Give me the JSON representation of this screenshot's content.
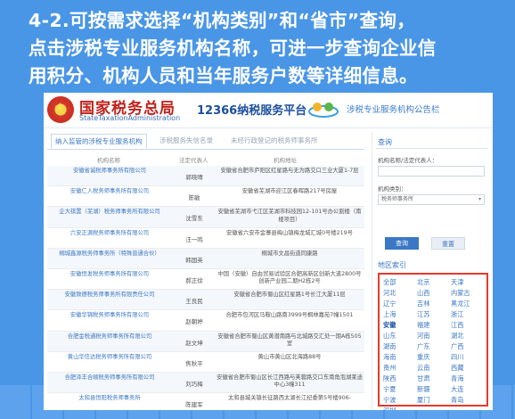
{
  "headline": {
    "line1": "4-2.可按需求选择“机构类别”和“省市”查询，",
    "line2": "点击涉税专业服务机构名称，可进一步查询企业信",
    "line3": "用积分、机构人员和当年服务户数等详细信息。"
  },
  "banner": {
    "org_cn": "国家税务总局",
    "org_en": "StateTaxationAdministration",
    "platform": "12366纳税服务平台",
    "subtitle": "涉税专业服务机构公告栏"
  },
  "tabs": [
    {
      "label": "纳入监管的涉税专业服务机构",
      "active": true
    },
    {
      "label": "涉税服务失信名录",
      "active": false
    },
    {
      "label": "未经行政登记的税务师事务所",
      "active": false
    }
  ],
  "table": {
    "headers": [
      "机构名称",
      "法定代表人",
      "机构地址"
    ],
    "rows": [
      {
        "name": "安徽省诚税师事务所有限公司",
        "rep": "郭晓晴",
        "addr": "安徽省合肥市庐阳区红星路与无为路交口三业大厦1-7层"
      },
      {
        "name": "安徽仁人税务师事务所有限公司",
        "rep": "陈敏",
        "addr": "安徽省芜湖市迎江区春晖路217号房屋"
      },
      {
        "name": "企大祺置（芜湖）税务师事务所有限公司",
        "rep": "沈雪东",
        "addr": "安徽省芜湖市弋江区芜湖市科技园12-101号办公割楼（南楼项目）"
      },
      {
        "name": "六安正源税务师事务所有限公司",
        "rep": "汪一鸣",
        "addr": "安徽省六安市金寨县梅山镇梅龙城汇城0号楼219号"
      },
      {
        "name": "桐城鑫源税务师事务所（特殊普通合伙）",
        "rep": "韩国英",
        "addr": "桐城市文昌街道同康路"
      },
      {
        "name": "安徽恒发税务师事务所有限公司",
        "rep": "郝正徐",
        "addr": "中国（安徽）自由贸易试验区合肥高新区创新大道2800号创新产业园二期H2栋2号"
      },
      {
        "name": "安徽致德税务师事务所有限责任公司",
        "rep": "王良民",
        "addr": "安徽省合肥市蜀山区红星路1号长江大厦11层"
      },
      {
        "name": "安徽华锦税务师事务所有限公司",
        "rep": "赵朝婷",
        "addr": "合肥市包河区马鞍山路南3999号桐林嘉苑7幢1501"
      },
      {
        "name": "合肥金税通税务师事务所有限公司",
        "rep": "赵文坤",
        "addr": "安徽省合肥市蜀山区黄潜南路与北城路交汇处一期A栋505室"
      },
      {
        "name": "黄山华信达税务师事务所有限公司",
        "rep": "焦秋平",
        "addr": "黄山市黄山区北海路88号"
      },
      {
        "name": "合肥泽丰合顺税务师事务所有限公司",
        "rep": "刘巧梅",
        "addr": "安徽省合肥市蜀山区长江西路与芙蓉路交口东南角泡湖莱迪中心3幢311"
      },
      {
        "name": "太和县恒阳税务师事务所",
        "rep": "陈建军",
        "addr": "太和县城关镇长征路西太湖长江纪委第5号楼906-"
      }
    ]
  },
  "query": {
    "title": "查询",
    "name_label": "机构名称/法定代表人：",
    "name_value": "",
    "category_label": "机构类别：",
    "category_value": "税务师事务所",
    "query_button": "查询",
    "reset_button": "重置"
  },
  "regions": {
    "title": "地区索引",
    "items": [
      "全部",
      "北京",
      "天津",
      "河北",
      "山西",
      "内蒙古",
      "辽宁",
      "吉林",
      "黑龙江",
      "上海",
      "江苏",
      "浙江",
      "安徽",
      "福建",
      "江西",
      "山东",
      "河南",
      "湖北",
      "湖南",
      "广东",
      "广西",
      "海南",
      "重庆",
      "四川",
      "贵州",
      "云南",
      "西藏",
      "陕西",
      "甘肃",
      "青海",
      "宁夏",
      "新疆",
      "大连",
      "宁波",
      "厦门",
      "青岛",
      "深圳"
    ],
    "selected": "安徽"
  },
  "colors": {
    "background": "#4a96e6",
    "highlight_border": "#e43a2c",
    "link": "#3a77c5",
    "brand_red": "#c2221b"
  }
}
